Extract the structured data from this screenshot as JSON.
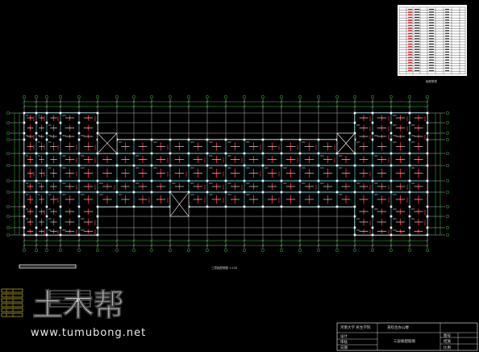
{
  "drawing": {
    "plan_caption": "三层板配筋图 1:100",
    "table_caption": "板配筋表",
    "scale_note": "1:100"
  },
  "title_block": {
    "school": "河南大学 民生学院",
    "project": "某综合办公楼",
    "drawing_name": "三层板配筋图",
    "row1_label": "设计",
    "row2_label": "审核",
    "row3_label": "日期",
    "right1": "图号",
    "right2": "结施",
    "right3": "比例"
  },
  "watermark": {
    "brand": "土木帮",
    "url": "www.tumubong.net"
  },
  "colors": {
    "background": "#000000",
    "grid": "#ffffff",
    "dim": "#3cc43c",
    "beam": "#5fd0d8",
    "rebar": "#e0202a",
    "text": "#ffffff"
  }
}
